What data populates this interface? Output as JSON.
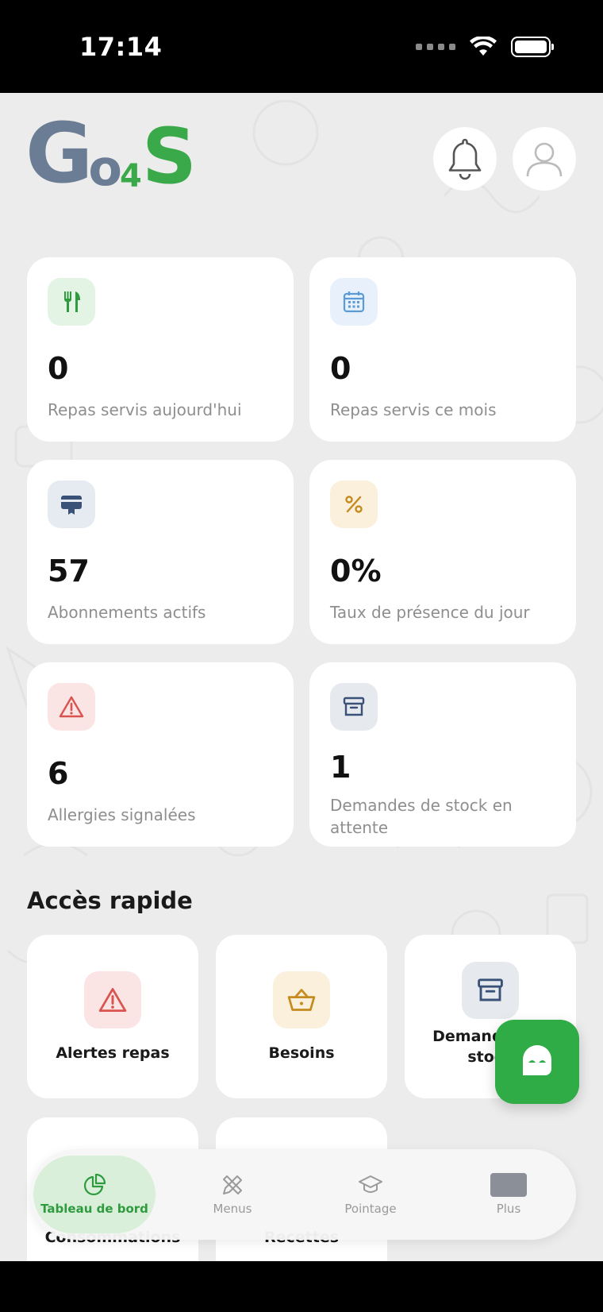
{
  "status_bar": {
    "time": "17:14"
  },
  "app": {
    "logo_text": "Go4S"
  },
  "stats": [
    {
      "value": "0",
      "label": "Repas servis aujourd'hui",
      "icon": "utensils-icon",
      "icon_color": "#2e9b3f",
      "icon_bg": "#e3f4e4"
    },
    {
      "value": "0",
      "label": "Repas servis ce mois",
      "icon": "calendar-icon",
      "icon_color": "#5b9bd5",
      "icon_bg": "#e8f1fb"
    },
    {
      "value": "57",
      "label": "Abonnements actifs",
      "icon": "card-icon",
      "icon_color": "#3b5278",
      "icon_bg": "#e6ebf2"
    },
    {
      "value": "0%",
      "label": "Taux de présence du jour",
      "icon": "percent-icon",
      "icon_color": "#c68b1e",
      "icon_bg": "#faf0dc"
    },
    {
      "value": "6",
      "label": "Allergies signalées",
      "icon": "warning-icon",
      "icon_color": "#d9534f",
      "icon_bg": "#fbe4e4"
    },
    {
      "value": "1",
      "label": "Demandes de stock en attente",
      "icon": "archive-icon",
      "icon_color": "#3b5278",
      "icon_bg": "#e6e9ee"
    }
  ],
  "quick_access": {
    "title": "Accès rapide",
    "items": [
      {
        "label": "Alertes repas",
        "icon": "warning-icon",
        "icon_bg": "#fbe4e4",
        "icon_color": "#d9534f"
      },
      {
        "label": "Besoins",
        "icon": "basket-icon",
        "icon_bg": "#faf0dc",
        "icon_color": "#c68b1e"
      },
      {
        "label_line1": "Demandes de",
        "label_line2": "stock",
        "icon": "archive-icon",
        "icon_bg": "#e6e9ee",
        "icon_color": "#3b5278"
      },
      {
        "label": "Consommations"
      },
      {
        "label": "Recettes"
      }
    ]
  },
  "bottom_nav": [
    {
      "label": "Tableau de bord",
      "icon": "chart-pie-icon",
      "active": true
    },
    {
      "label": "Menus",
      "icon": "pencil-ruler-icon",
      "active": false
    },
    {
      "label": "Pointage",
      "icon": "graduation-cap-icon",
      "active": false
    },
    {
      "label": "Plus",
      "icon": "more-icon",
      "active": false
    }
  ],
  "colors": {
    "brand_green": "#30ac47",
    "brand_slate": "#6b7c95"
  }
}
